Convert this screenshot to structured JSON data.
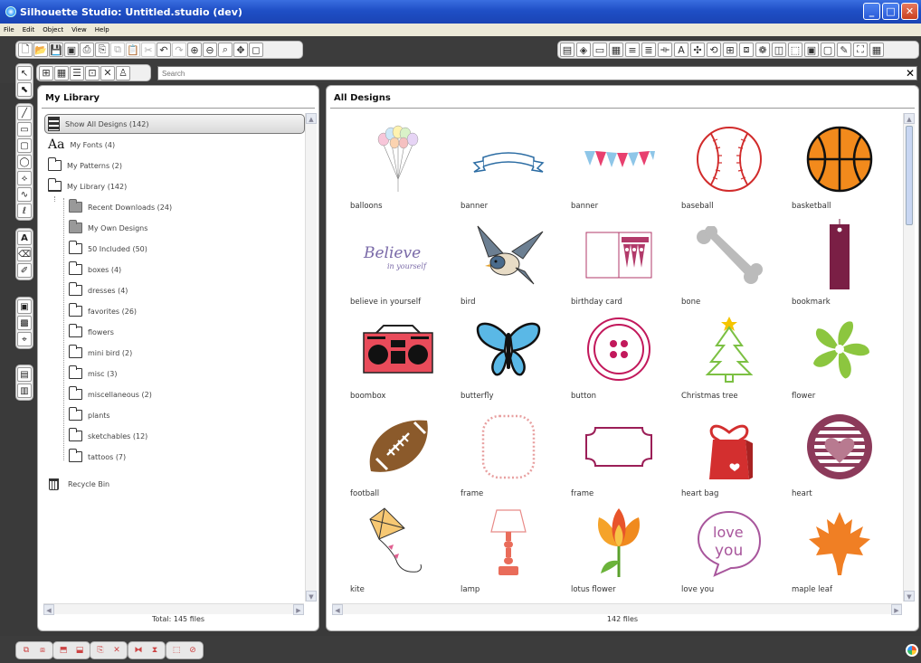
{
  "window": {
    "title": "Silhouette Studio: Untitled.studio (dev)"
  },
  "menu": [
    "File",
    "Edit",
    "Object",
    "View",
    "Help"
  ],
  "search": {
    "placeholder": "Search"
  },
  "library": {
    "title": "My Library",
    "items": [
      {
        "label": "Show All Designs (142)",
        "icon": "show-all-icon",
        "selected": true
      },
      {
        "label": "My Fonts (4)",
        "icon": "font-icon"
      },
      {
        "label": "My Patterns (2)",
        "icon": "folder-icon"
      },
      {
        "label": "My Library (142)",
        "icon": "folder-open-icon"
      },
      {
        "label": "Recent Downloads (24)",
        "icon": "folder-grey-icon"
      },
      {
        "label": "My Own Designs",
        "icon": "folder-grey-icon"
      },
      {
        "label": "50 Included (50)",
        "icon": "folder-icon"
      },
      {
        "label": "boxes (4)",
        "icon": "folder-icon"
      },
      {
        "label": "dresses (4)",
        "icon": "folder-icon"
      },
      {
        "label": "favorites (26)",
        "icon": "folder-icon"
      },
      {
        "label": "flowers",
        "icon": "folder-icon"
      },
      {
        "label": "mini bird (2)",
        "icon": "folder-icon"
      },
      {
        "label": "misc (3)",
        "icon": "folder-icon"
      },
      {
        "label": "miscellaneous (2)",
        "icon": "folder-icon"
      },
      {
        "label": "plants",
        "icon": "folder-icon"
      },
      {
        "label": "sketchables (12)",
        "icon": "folder-icon"
      },
      {
        "label": "tattoos (7)",
        "icon": "folder-icon"
      },
      {
        "label": "Recycle Bin",
        "icon": "recycle-bin-icon"
      }
    ],
    "footer": "Total: 145 files"
  },
  "designs": {
    "title": "All Designs",
    "items": [
      {
        "label": "balloons"
      },
      {
        "label": "banner"
      },
      {
        "label": "banner"
      },
      {
        "label": "baseball"
      },
      {
        "label": "basketball"
      },
      {
        "label": "believe in yourself"
      },
      {
        "label": "bird"
      },
      {
        "label": "birthday card"
      },
      {
        "label": "bone"
      },
      {
        "label": "bookmark"
      },
      {
        "label": "boombox"
      },
      {
        "label": "butterfly"
      },
      {
        "label": "button"
      },
      {
        "label": "Christmas tree"
      },
      {
        "label": "flower"
      },
      {
        "label": "football"
      },
      {
        "label": "frame"
      },
      {
        "label": "frame"
      },
      {
        "label": "heart bag"
      },
      {
        "label": "heart"
      },
      {
        "label": "kite"
      },
      {
        "label": "lamp"
      },
      {
        "label": "lotus flower"
      },
      {
        "label": "love you"
      },
      {
        "label": "maple leaf"
      }
    ],
    "footer": "142 files",
    "art_text": {
      "believe": "Believe",
      "in_yourself": "in yourself",
      "love": "love",
      "you": "you"
    }
  },
  "colors": {
    "accent": "#1f4fc6",
    "toolbar": "#3c3c3c",
    "magenta": "#c2185b",
    "orange": "#f08b1e",
    "green": "#8cc63f"
  }
}
